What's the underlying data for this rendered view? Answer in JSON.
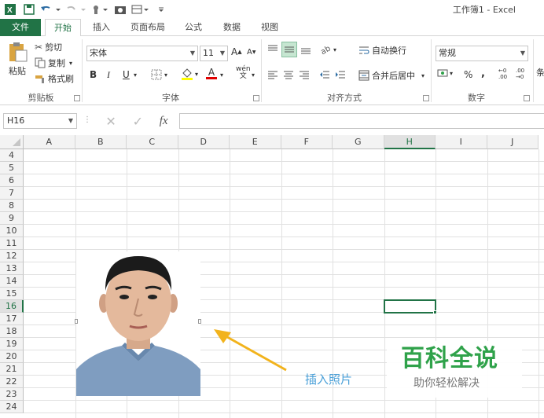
{
  "window": {
    "title": "工作簿1 - Excel"
  },
  "tabs": [
    "文件",
    "开始",
    "插入",
    "页面布局",
    "公式",
    "数据",
    "视图"
  ],
  "ribbon": {
    "clipboard": {
      "paste": "粘贴",
      "cut": "剪切",
      "copy": "复制",
      "format_painter": "格式刷",
      "label": "剪贴板"
    },
    "font": {
      "name": "宋体",
      "size": "11",
      "bold": "B",
      "italic": "I",
      "underline": "U",
      "label": "字体",
      "grow": "A",
      "shrink": "A",
      "font_color": "A",
      "phonetic": "wén"
    },
    "alignment": {
      "wrap_text": "自动换行",
      "merge_center": "合并后居中",
      "label": "对齐方式"
    },
    "number": {
      "format": "常规",
      "percent": "%",
      "comma": ",",
      "label": "数字",
      "inc_decimal": "←0\n.00",
      "dec_decimal": ".00\n→0"
    },
    "styles": {
      "partial": "条"
    }
  },
  "formula_bar": {
    "name_box": "H16",
    "formula": "",
    "fx": "fx"
  },
  "grid": {
    "columns": [
      "A",
      "B",
      "C",
      "D",
      "E",
      "F",
      "G",
      "H",
      "I",
      "J"
    ],
    "rows": [
      "4",
      "5",
      "6",
      "7",
      "8",
      "9",
      "10",
      "11",
      "12",
      "13",
      "14",
      "15",
      "16",
      "17",
      "18",
      "19",
      "20",
      "21",
      "22",
      "23",
      "24"
    ],
    "selected_cell": "H16"
  },
  "annotation": {
    "text": "插入照片"
  },
  "watermark": {
    "line1": "百科全说",
    "line2": "助你轻松解决"
  },
  "colors": {
    "excel_green": "#217346",
    "annotation": "#4aa0d8",
    "arrow": "#f2b31c",
    "watermark_green": "#2fa24a"
  }
}
